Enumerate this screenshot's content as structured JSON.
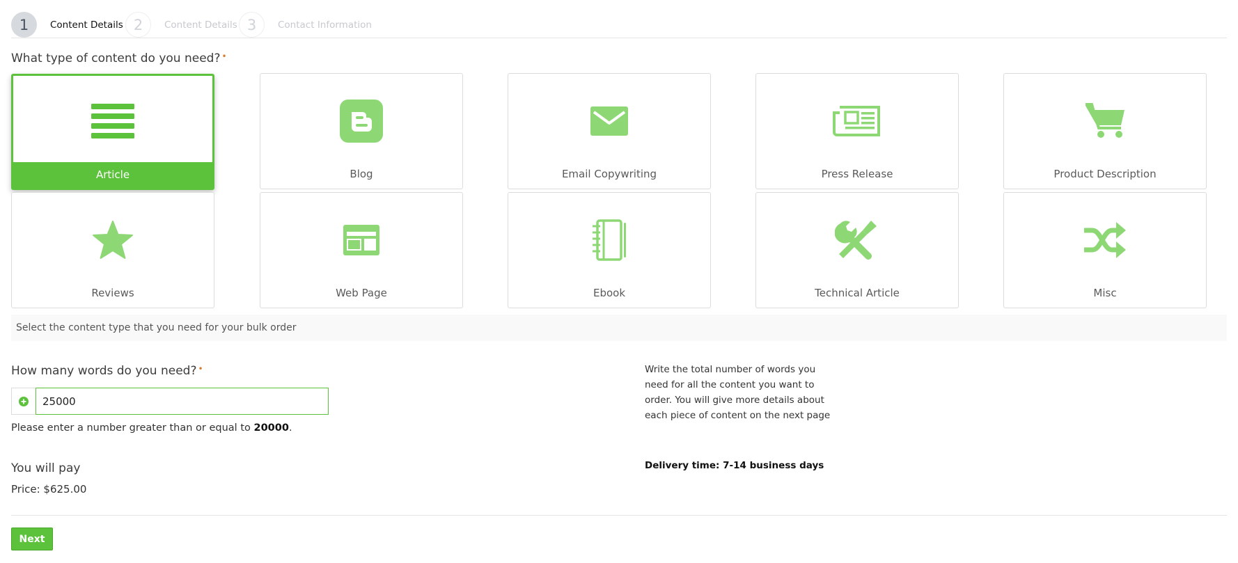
{
  "steps": [
    {
      "number": "1",
      "label": "Content Details"
    },
    {
      "number": "2",
      "label": "Content Details"
    },
    {
      "number": "3",
      "label": "Contact Information"
    }
  ],
  "content_question": {
    "label": "What type of content do you need?",
    "required_mark": "•"
  },
  "content_types": [
    {
      "label": "Article",
      "icon": "article-icon",
      "selected": true
    },
    {
      "label": "Blog",
      "icon": "blogger-icon"
    },
    {
      "label": "Email Copywriting",
      "icon": "envelope-icon"
    },
    {
      "label": "Press Release",
      "icon": "newspaper-icon"
    },
    {
      "label": "Product Description",
      "icon": "shopping-cart-icon"
    },
    {
      "label": "Reviews",
      "icon": "star-icon"
    },
    {
      "label": "Web Page",
      "icon": "web-page-icon"
    },
    {
      "label": "Ebook",
      "icon": "notebook-icon"
    },
    {
      "label": "Technical Article",
      "icon": "tools-icon"
    },
    {
      "label": "Misc",
      "icon": "shuffle-icon"
    }
  ],
  "content_help": "Select the content type that you need for your bulk order",
  "words_question": {
    "label": "How many words do you need?",
    "required_mark": "•"
  },
  "words_input": {
    "value": "25000"
  },
  "words_hint": {
    "prefix": "Please enter a number greater than or equal to ",
    "min": "20000",
    "suffix": "."
  },
  "words_note": "Write the total number of words you need for all the content you want to order. You will give more details about each piece of content on the next page",
  "delivery": "Delivery time: 7-14 business days",
  "pay": {
    "title": "You will pay",
    "price": "Price: $625.00"
  },
  "next_label": "Next",
  "colors": {
    "accent": "#5cc23c",
    "icon_light": "#8dd875"
  }
}
